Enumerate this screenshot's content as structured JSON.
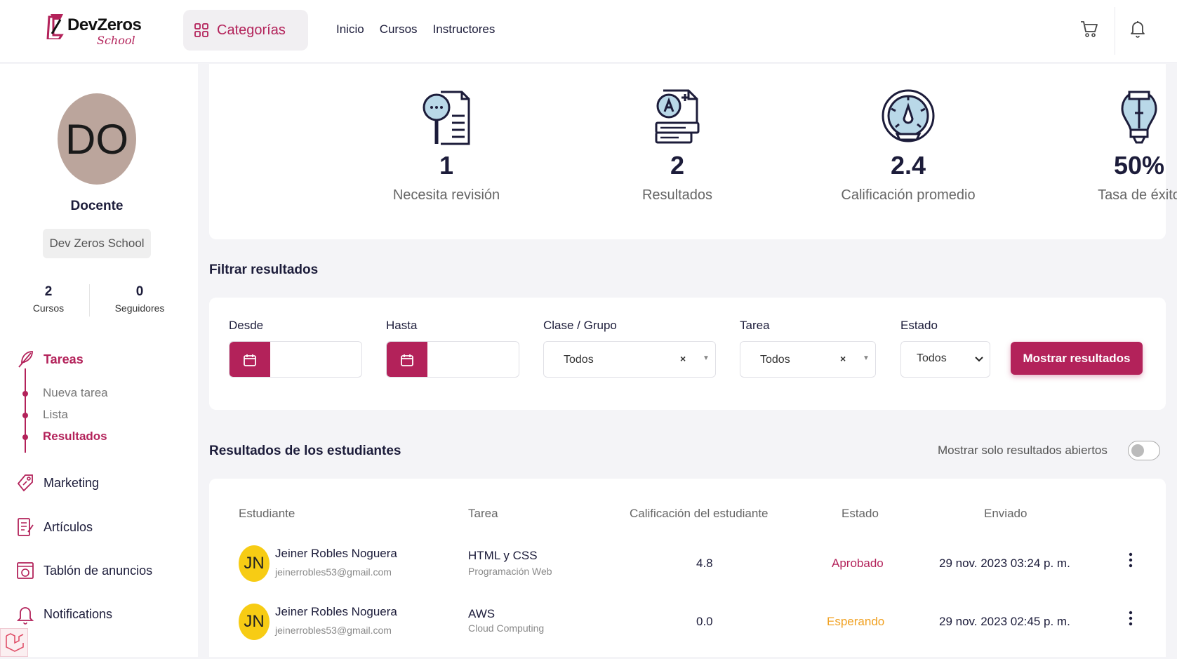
{
  "header": {
    "logo_text": "DevZeros",
    "logo_sub": "School",
    "categories_label": "Categorías",
    "nav": [
      "Inicio",
      "Cursos",
      "Instructores"
    ]
  },
  "profile": {
    "initials": "DO",
    "role": "Docente",
    "school": "Dev Zeros School",
    "stats": [
      {
        "value": "2",
        "label": "Cursos"
      },
      {
        "value": "0",
        "label": "Seguidores"
      }
    ]
  },
  "sidebar": {
    "tasks_label": "Tareas",
    "sub_items": [
      "Nueva tarea",
      "Lista",
      "Resultados"
    ],
    "marketing": "Marketing",
    "articles": "Artículos",
    "board": "Tablón de anuncios",
    "notifications": "Notifications"
  },
  "summary": [
    {
      "value": "1",
      "label": "Necesita revisión",
      "icon": "review-icon"
    },
    {
      "value": "2",
      "label": "Resultados",
      "icon": "results-icon"
    },
    {
      "value": "2.4",
      "label": "Calificación promedio",
      "icon": "gauge-icon"
    },
    {
      "value": "50%",
      "label": "Tasa de éxito",
      "icon": "bulb-icon"
    }
  ],
  "filter": {
    "title": "Filtrar resultados",
    "from_label": "Desde",
    "to_label": "Hasta",
    "class_label": "Clase / Grupo",
    "class_value": "Todos",
    "task_label": "Tarea",
    "task_value": "Todos",
    "status_label": "Estado",
    "status_value": "Todos",
    "button": "Mostrar resultados"
  },
  "results": {
    "title": "Resultados de los estudiantes",
    "toggle_label": "Mostrar solo resultados abiertos",
    "columns": [
      "Estudiante",
      "Tarea",
      "Calificación del estudiante",
      "Estado",
      "Enviado"
    ],
    "rows": [
      {
        "initials": "JN",
        "name": "Jeiner Robles Noguera",
        "email": "jeinerrobles53@gmail.com",
        "task": "HTML y CSS",
        "course": "Programación Web",
        "grade": "4.8",
        "status": "Aprobado",
        "status_color": "#b3225a",
        "date": "29 nov. 2023 03:24 p. m."
      },
      {
        "initials": "JN",
        "name": "Jeiner Robles Noguera",
        "email": "jeinerrobles53@gmail.com",
        "task": "AWS",
        "course": "Cloud Computing",
        "grade": "0.0",
        "status": "Esperando",
        "status_color": "#f0a020",
        "date": "29 nov. 2023 02:45 p. m."
      }
    ]
  },
  "colors": {
    "accent": "#b3225a",
    "dark": "#1c1c3a",
    "avatar_yellow": "#f7cc14"
  }
}
